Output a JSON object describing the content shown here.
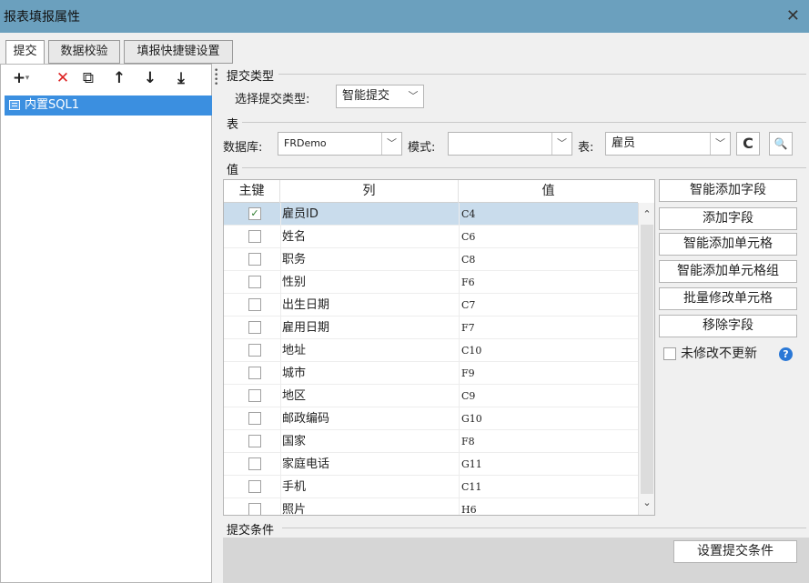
{
  "window": {
    "title": "报表填报属性",
    "close_glyph": "✕"
  },
  "tabs": [
    {
      "label": "提交",
      "active": true
    },
    {
      "label": "数据校验",
      "active": false
    },
    {
      "label": "填报快捷键设置",
      "active": false
    }
  ],
  "left_toolbar": {
    "add_icon": "+",
    "add_dropdown": "▾",
    "delete_icon": "✕",
    "copy_icon": "⧉",
    "up_icon": "↑",
    "down_icon": "↓",
    "bottom_icon": "⤓"
  },
  "tree": {
    "items": [
      {
        "label": "内置SQL1",
        "selected": true
      }
    ]
  },
  "submit_type": {
    "group_label": "提交类型",
    "select_label": "选择提交类型:",
    "select_value": "智能提交"
  },
  "table_section": {
    "group_label": "表",
    "database_label": "数据库:",
    "database_value": "FRDemo",
    "mode_label": "模式:",
    "mode_value": "",
    "table_label": "表:",
    "table_value": "雇员",
    "refresh_icon": "C",
    "preview_icon": "🔍"
  },
  "value_section": {
    "group_label": "值",
    "columns": [
      "主键",
      "列",
      "值"
    ],
    "rows": [
      {
        "key": true,
        "column": "雇员ID",
        "value": "C4",
        "selected": true
      },
      {
        "key": false,
        "column": "姓名",
        "value": "C6"
      },
      {
        "key": false,
        "column": "职务",
        "value": "C8"
      },
      {
        "key": false,
        "column": "性别",
        "value": "F6"
      },
      {
        "key": false,
        "column": "出生日期",
        "value": "C7"
      },
      {
        "key": false,
        "column": "雇用日期",
        "value": "F7"
      },
      {
        "key": false,
        "column": "地址",
        "value": "C10"
      },
      {
        "key": false,
        "column": "城市",
        "value": "F9"
      },
      {
        "key": false,
        "column": "地区",
        "value": "C9"
      },
      {
        "key": false,
        "column": "邮政编码",
        "value": "G10"
      },
      {
        "key": false,
        "column": "国家",
        "value": "F8"
      },
      {
        "key": false,
        "column": "家庭电话",
        "value": "G11"
      },
      {
        "key": false,
        "column": "手机",
        "value": "C11"
      },
      {
        "key": false,
        "column": "照片",
        "value": "H6"
      }
    ],
    "check_glyph": "✓",
    "scroll_up": "⌃",
    "scroll_down": "⌄"
  },
  "right_buttons": {
    "smart_add_field": "智能添加字段",
    "add_field": "添加字段",
    "smart_add_cell": "智能添加单元格",
    "smart_add_cell_group": "智能添加单元格组",
    "batch_modify_cell": "批量修改单元格",
    "remove_field": "移除字段"
  },
  "no_change_option": {
    "label": "未修改不更新",
    "checked": false,
    "help_glyph": "?"
  },
  "submit_condition": {
    "group_label": "提交条件",
    "button": "设置提交条件"
  }
}
